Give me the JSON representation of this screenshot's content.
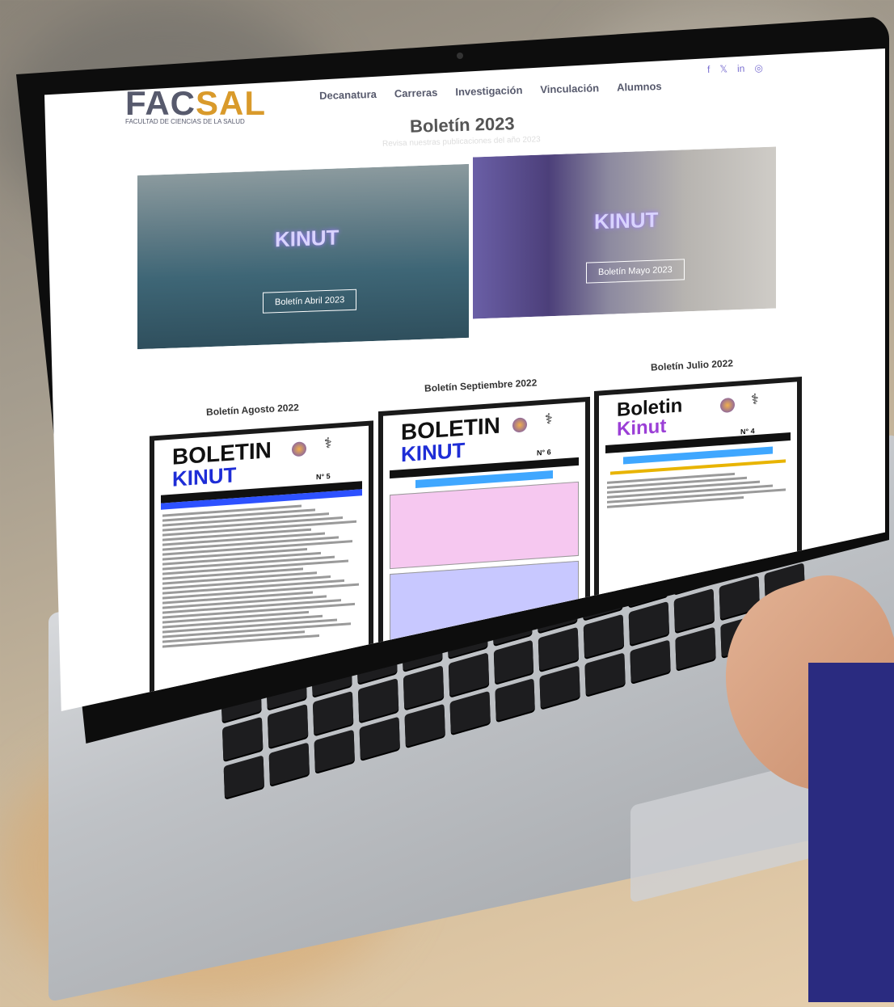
{
  "site": {
    "logo_main": "FAC",
    "logo_accent": "SAL",
    "logo_sub": "FACULTAD DE CIENCIAS DE LA SALUD"
  },
  "nav": {
    "items": [
      "Decanatura",
      "Carreras",
      "Investigación",
      "Vinculación",
      "Alumnos"
    ]
  },
  "social": {
    "items": [
      "f",
      "𝕏",
      "in",
      "◎"
    ]
  },
  "page": {
    "title": "Boletín 2023",
    "subtitle": "Revisa nuestras publicaciones del año 2023"
  },
  "featured": [
    {
      "button": "Boletín Abril 2023",
      "art": "KINUT"
    },
    {
      "button": "Boletín Mayo 2023",
      "art": "KINUT"
    }
  ],
  "bulletins": [
    {
      "title": "Boletín Agosto 2022",
      "line1": "BOLETIN",
      "line2": "KINUT",
      "number": "N° 5"
    },
    {
      "title": "Boletín Septiembre 2022",
      "line1": "BOLETIN",
      "line2": "KINUT",
      "number": "N° 6"
    },
    {
      "title": "Boletín Julio 2022",
      "line1": "Boletin",
      "line2": "Kinut",
      "number": "N° 4"
    }
  ],
  "colors": {
    "nav_text": "#575a6d",
    "logo_accent": "#d99a2b",
    "kinut_blue": "#1e2dd6",
    "sleeve": "#2a2b80"
  }
}
